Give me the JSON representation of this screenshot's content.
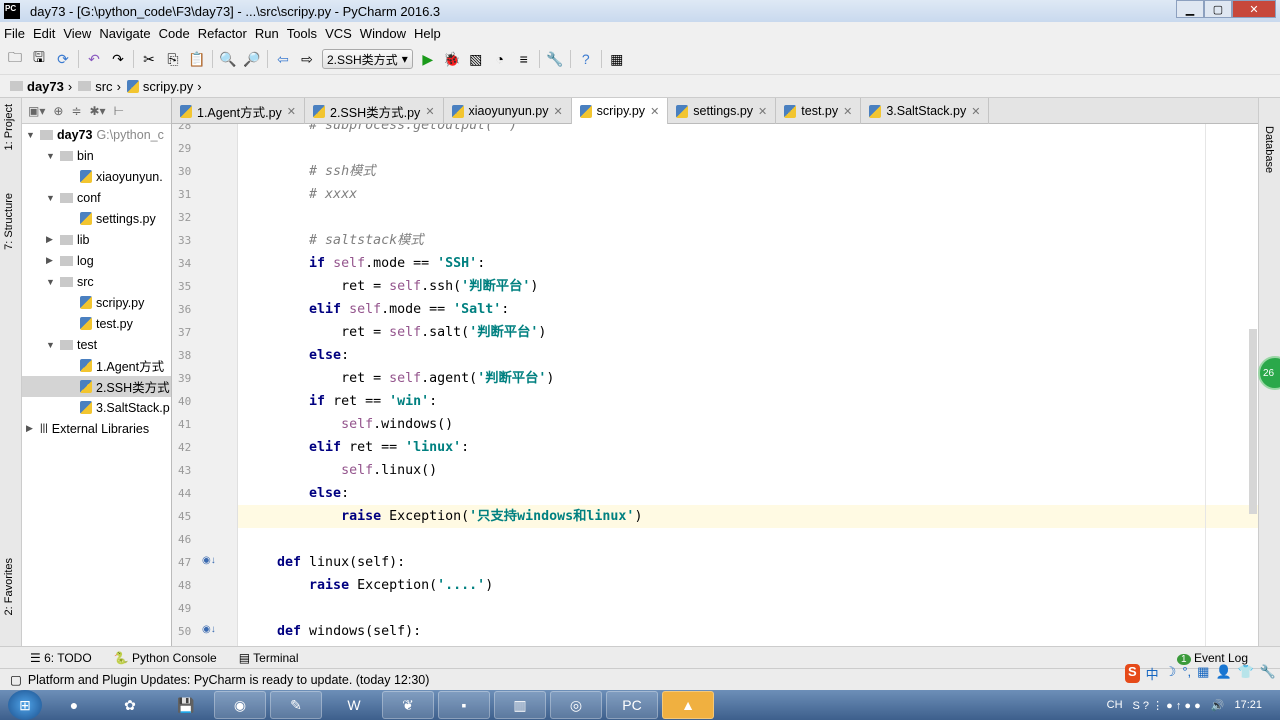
{
  "window": {
    "title": "day73 - [G:\\python_code\\F3\\day73] - ...\\src\\scripy.py - PyCharm 2016.3",
    "logo": "PC",
    "controls": [
      "minimize-icon",
      "maximize-icon",
      "close-icon"
    ]
  },
  "menu": [
    "File",
    "Edit",
    "View",
    "Navigate",
    "Code",
    "Refactor",
    "Run",
    "Tools",
    "VCS",
    "Window",
    "Help"
  ],
  "toolbar": {
    "run_config": "2.SSH类方式",
    "icons": [
      "open-icon",
      "save-icon",
      "sync-icon",
      "undo-icon",
      "redo-icon",
      "cut-icon",
      "copy-icon",
      "paste-icon",
      "find-icon",
      "replace-icon",
      "back-icon",
      "forward-icon",
      "run-icon",
      "debug-icon",
      "coverage-icon",
      "profile-icon",
      "concurrency-icon",
      "settings-icon",
      "help-icon",
      "sdk-icon"
    ]
  },
  "breadcrumb": [
    "day73",
    "src",
    "scripy.py"
  ],
  "left_strip": [
    "1: Project",
    "7: Structure",
    "2: Favorites"
  ],
  "right_strip": [
    "Database"
  ],
  "project_tree": [
    {
      "label": "day73",
      "extra": "G:\\python_c",
      "level": 0,
      "type": "folder",
      "open": true,
      "bold": true
    },
    {
      "label": "bin",
      "level": 1,
      "type": "folder",
      "open": true
    },
    {
      "label": "xiaoyunyun.",
      "level": 2,
      "type": "py"
    },
    {
      "label": "conf",
      "level": 1,
      "type": "folder",
      "open": true
    },
    {
      "label": "settings.py",
      "level": 2,
      "type": "py"
    },
    {
      "label": "lib",
      "level": 1,
      "type": "folder"
    },
    {
      "label": "log",
      "level": 1,
      "type": "folder"
    },
    {
      "label": "src",
      "level": 1,
      "type": "folder",
      "open": true
    },
    {
      "label": "scripy.py",
      "level": 2,
      "type": "py"
    },
    {
      "label": "test.py",
      "level": 2,
      "type": "py"
    },
    {
      "label": "test",
      "level": 1,
      "type": "folder",
      "open": true
    },
    {
      "label": "1.Agent方式",
      "level": 2,
      "type": "py"
    },
    {
      "label": "2.SSH类方式",
      "level": 2,
      "type": "py",
      "selected": true
    },
    {
      "label": "3.SaltStack.p",
      "level": 2,
      "type": "py"
    },
    {
      "label": "External Libraries",
      "level": 0,
      "type": "lib"
    }
  ],
  "tabs": [
    {
      "label": "1.Agent方式.py"
    },
    {
      "label": "2.SSH类方式.py"
    },
    {
      "label": "xiaoyunyun.py"
    },
    {
      "label": "scripy.py",
      "active": true
    },
    {
      "label": "settings.py"
    },
    {
      "label": "test.py"
    },
    {
      "label": "3.SaltStack.py"
    }
  ],
  "editor": {
    "caret_line": 45,
    "lines": [
      {
        "n": "28",
        "t": [
          [
            "cm",
            "        # subprocess.getoutput('')"
          ]
        ]
      },
      {
        "n": "29",
        "t": []
      },
      {
        "n": "30",
        "t": [
          [
            "cm",
            "        # ssh模式"
          ]
        ]
      },
      {
        "n": "31",
        "t": [
          [
            "cm",
            "        # xxxx"
          ]
        ]
      },
      {
        "n": "32",
        "t": []
      },
      {
        "n": "33",
        "t": [
          [
            "cm",
            "        # saltstack模式"
          ]
        ]
      },
      {
        "n": "34",
        "t": [
          [
            "kw",
            "        if "
          ],
          [
            "self",
            "self"
          ],
          [
            "pl",
            ".mode == "
          ],
          [
            "str",
            "'SSH'"
          ],
          [
            "pl",
            ":"
          ]
        ]
      },
      {
        "n": "35",
        "t": [
          [
            "pl",
            "            ret = "
          ],
          [
            "self",
            "self"
          ],
          [
            "pl",
            ".ssh("
          ],
          [
            "str",
            "'判断平台'"
          ],
          [
            "pl",
            ")"
          ]
        ]
      },
      {
        "n": "36",
        "t": [
          [
            "kw",
            "        elif "
          ],
          [
            "self",
            "self"
          ],
          [
            "pl",
            ".mode == "
          ],
          [
            "str",
            "'Salt'"
          ],
          [
            "pl",
            ":"
          ]
        ]
      },
      {
        "n": "37",
        "t": [
          [
            "pl",
            "            ret = "
          ],
          [
            "self",
            "self"
          ],
          [
            "pl",
            ".salt("
          ],
          [
            "str",
            "'判断平台'"
          ],
          [
            "pl",
            ")"
          ]
        ]
      },
      {
        "n": "38",
        "t": [
          [
            "kw",
            "        else"
          ],
          [
            "pl",
            ":"
          ]
        ]
      },
      {
        "n": "39",
        "t": [
          [
            "pl",
            "            ret = "
          ],
          [
            "self",
            "self"
          ],
          [
            "pl",
            ".agent("
          ],
          [
            "str",
            "'判断平台'"
          ],
          [
            "pl",
            ")"
          ]
        ]
      },
      {
        "n": "40",
        "t": [
          [
            "kw",
            "        if "
          ],
          [
            "pl",
            "ret == "
          ],
          [
            "str",
            "'win'"
          ],
          [
            "pl",
            ":"
          ]
        ]
      },
      {
        "n": "41",
        "t": [
          [
            "self",
            "            self"
          ],
          [
            "pl",
            ".windows()"
          ]
        ]
      },
      {
        "n": "42",
        "t": [
          [
            "kw",
            "        elif "
          ],
          [
            "pl",
            "ret == "
          ],
          [
            "str",
            "'linux'"
          ],
          [
            "pl",
            ":"
          ]
        ]
      },
      {
        "n": "43",
        "t": [
          [
            "self",
            "            self"
          ],
          [
            "pl",
            ".linux()"
          ]
        ]
      },
      {
        "n": "44",
        "t": [
          [
            "kw",
            "        else"
          ],
          [
            "pl",
            ":"
          ]
        ]
      },
      {
        "n": "45",
        "t": [
          [
            "kw",
            "            raise "
          ],
          [
            "pl",
            "Exception("
          ],
          [
            "str",
            "'只支持windows和linux'"
          ],
          [
            "pl",
            ")"
          ]
        ]
      },
      {
        "n": "46",
        "t": []
      },
      {
        "n": "47",
        "t": [
          [
            "kw",
            "    def "
          ],
          [
            "pl",
            "linux(self):"
          ]
        ]
      },
      {
        "n": "48",
        "t": [
          [
            "kw",
            "        raise "
          ],
          [
            "pl",
            "Exception("
          ],
          [
            "str",
            "'....'"
          ],
          [
            "pl",
            ")"
          ]
        ]
      },
      {
        "n": "49",
        "t": []
      },
      {
        "n": "50",
        "t": [
          [
            "kw",
            "    def "
          ],
          [
            "pl",
            "windows(self):"
          ]
        ]
      }
    ]
  },
  "bottom_tools": [
    "6: TODO",
    "Python Console",
    "Terminal"
  ],
  "event_log": "Event Log",
  "event_count": "1",
  "status_message": "Platform and Plugin Updates: PyCharm is ready to update. (today 12:30)",
  "badge": "26",
  "ime": [
    "S",
    "中",
    "☽",
    "°,",
    "▦",
    "👤",
    "👕",
    "🔧"
  ],
  "taskbar": {
    "time": "17:21",
    "tray_lang": "CH"
  },
  "colors": {
    "keyword": "#000080",
    "string": "#008080",
    "self": "#94558d",
    "comment": "#808080",
    "caret_line": "#fffae3"
  }
}
